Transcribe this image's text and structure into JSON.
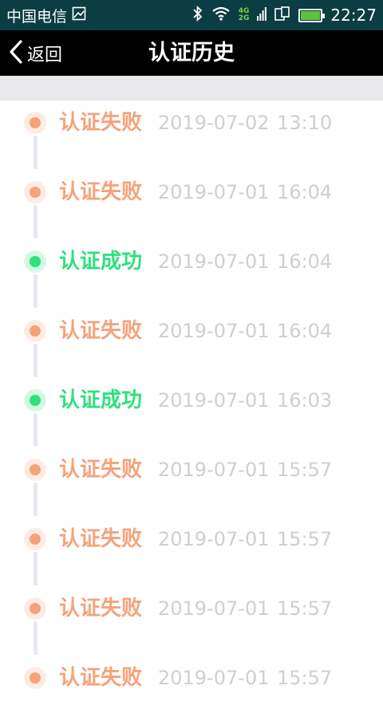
{
  "status_bar": {
    "carrier": "中国电信",
    "network_top": "4G",
    "network_bottom": "2G",
    "time": "22:27"
  },
  "header": {
    "back_label": "返回",
    "title": "认证历史"
  },
  "colors": {
    "fail": "#f5a27a",
    "success": "#2ee07e"
  },
  "records": [
    {
      "status": "认证失败",
      "type": "fail",
      "date": "2019-07-02",
      "time": "13:10"
    },
    {
      "status": "认证失败",
      "type": "fail",
      "date": "2019-07-01",
      "time": "16:04"
    },
    {
      "status": "认证成功",
      "type": "success",
      "date": "2019-07-01",
      "time": "16:04"
    },
    {
      "status": "认证失败",
      "type": "fail",
      "date": "2019-07-01",
      "time": "16:04"
    },
    {
      "status": "认证成功",
      "type": "success",
      "date": "2019-07-01",
      "time": "16:03"
    },
    {
      "status": "认证失败",
      "type": "fail",
      "date": "2019-07-01",
      "time": "15:57"
    },
    {
      "status": "认证失败",
      "type": "fail",
      "date": "2019-07-01",
      "time": "15:57"
    },
    {
      "status": "认证失败",
      "type": "fail",
      "date": "2019-07-01",
      "time": "15:57"
    },
    {
      "status": "认证失败",
      "type": "fail",
      "date": "2019-07-01",
      "time": "15:57"
    }
  ]
}
